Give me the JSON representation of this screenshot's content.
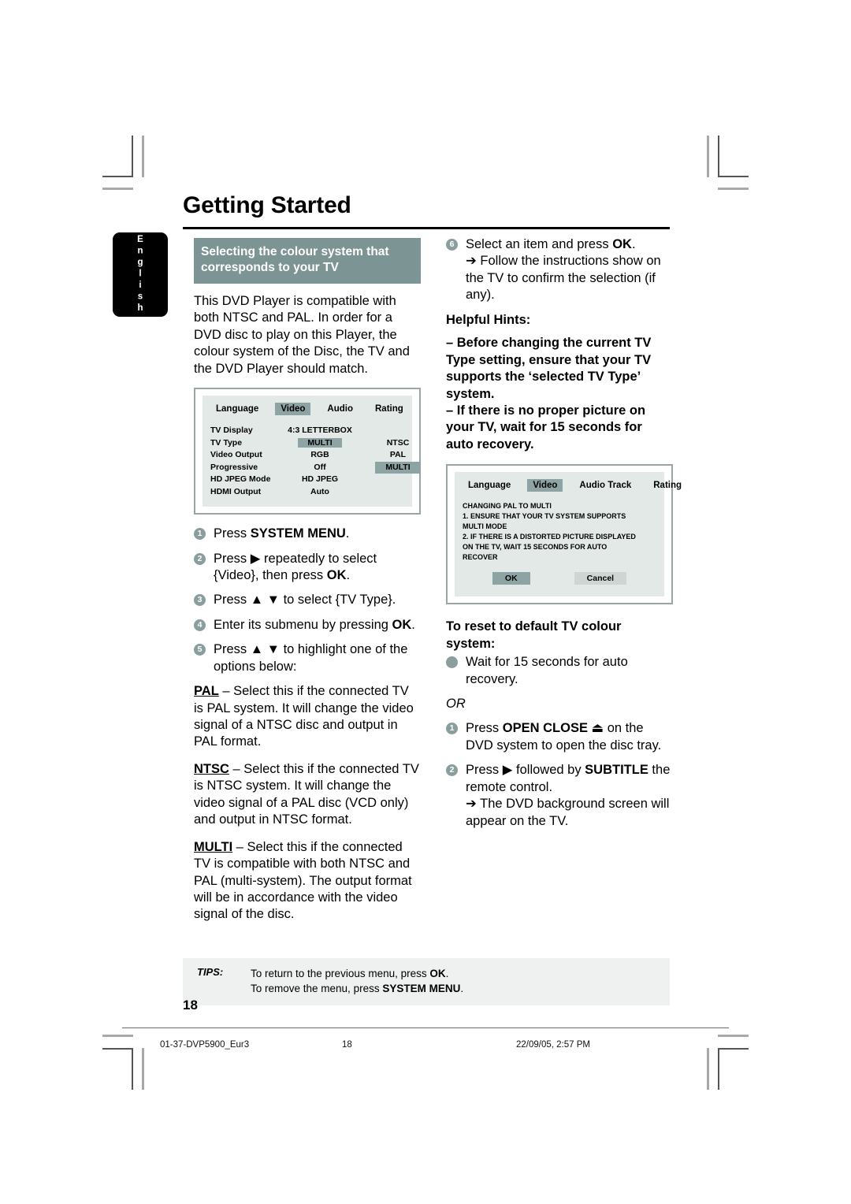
{
  "page": {
    "chapter_title": "Getting Started",
    "side_tab": "English",
    "page_number": "18"
  },
  "left_column": {
    "section_heading": "Selecting the colour system that corresponds to your TV",
    "intro": "This DVD Player is compatible with both NTSC and PAL. In order for a DVD disc to play on this Player, the colour system of the Disc, the TV and the DVD Player should match.",
    "steps": [
      {
        "num": "1",
        "text_html": "Press <span class=\"b\">SYSTEM MENU</span>."
      },
      {
        "num": "2",
        "text_html": "Press ▶ repeatedly to select {Video}, then press <span class=\"b\">OK</span>."
      },
      {
        "num": "3",
        "text_html": "Press ▲ ▼ to select {TV Type}."
      },
      {
        "num": "4",
        "text_html": "Enter its submenu by pressing <span class=\"b\">OK</span>."
      },
      {
        "num": "5",
        "text_html": "Press ▲ ▼ to highlight one of the options below:"
      }
    ],
    "options": [
      {
        "term": "PAL",
        "text": " – Select this if the connected TV is PAL system. It will change the video signal of a NTSC disc and output in PAL format."
      },
      {
        "term": "NTSC",
        "text": " – Select this if the connected TV is NTSC system. It will change the video signal of a PAL disc (VCD only) and output in NTSC format."
      },
      {
        "term": "MULTI",
        "text": " – Select this if the connected TV is compatible with both NTSC and PAL (multi-system). The output format will be in accordance with the video signal of the disc."
      }
    ]
  },
  "osd_video_menu": {
    "tabs": [
      {
        "label": "Language",
        "selected": false
      },
      {
        "label": "Video",
        "selected": true
      },
      {
        "label": "Audio",
        "selected": false
      },
      {
        "label": "Rating",
        "selected": false
      }
    ],
    "rows": [
      {
        "key": "TV Display",
        "value": "4:3 LETTERBOX",
        "highlighted": false
      },
      {
        "key": "TV Type",
        "value": "MULTI",
        "highlighted": true
      },
      {
        "key": "Video Output",
        "value": "RGB",
        "highlighted": false
      },
      {
        "key": "Progressive",
        "value": "Off",
        "highlighted": false
      },
      {
        "key": "HD JPEG Mode",
        "value": "HD JPEG",
        "highlighted": false
      },
      {
        "key": "HDMI Output",
        "value": "Auto",
        "highlighted": false
      }
    ],
    "submenu": [
      {
        "label": "",
        "highlighted": false
      },
      {
        "label": "NTSC",
        "highlighted": false
      },
      {
        "label": "PAL",
        "highlighted": false
      },
      {
        "label": "MULTI",
        "highlighted": true
      }
    ]
  },
  "osd_confirm_dialog": {
    "tabs": [
      {
        "label": "Language",
        "selected": false
      },
      {
        "label": "Video",
        "selected": true
      },
      {
        "label": "Audio Track",
        "selected": false
      },
      {
        "label": "Rating",
        "selected": false
      }
    ],
    "message_lines": [
      "CHANGING PAL TO MULTI",
      "1. ENSURE THAT YOUR TV SYSTEM SUPPORTS",
      "MULTI MODE",
      "2. IF THERE IS A DISTORTED PICTURE DISPLAYED",
      "ON THE TV, WAIT 15 SECONDS FOR AUTO",
      "RECOVER"
    ],
    "buttons": [
      {
        "label": "OK",
        "selected": true
      },
      {
        "label": "Cancel",
        "selected": false
      }
    ]
  },
  "right_column": {
    "step6": {
      "num": "6",
      "text_html": "Select an item and press <span class=\"b\">OK</span>.",
      "result": "➔ Follow the instructions show on the TV to confirm the selection (if any)."
    },
    "helpful_hints_title": "Helpful Hints:",
    "helpful_hints": [
      "–  Before changing the current TV Type setting, ensure that your TV supports the ‘selected TV Type’ system.",
      "–  If there is no proper picture on your TV, wait for 15 seconds for auto recovery."
    ],
    "reset_heading": "To reset to default TV colour system:",
    "reset_bullet": "Wait for 15 seconds for auto recovery.",
    "or_label": "OR",
    "reset_steps": [
      {
        "num": "1",
        "text_html": "Press <span class=\"b\">OPEN CLOSE</span> ⏏ on the DVD system to open the disc tray."
      },
      {
        "num": "2",
        "text_html": "Press ▶ followed by <span class=\"b\">SUBTITLE</span> the remote control."
      }
    ],
    "reset_result": "➔ The DVD background screen will appear on the TV."
  },
  "tips": {
    "label": "TIPS:",
    "line1_html": "To return to the previous menu, press <span class=\"b\">OK</span>.",
    "line2_html": "To remove the menu, press <span class=\"b\">SYSTEM MENU</span>."
  },
  "footer": {
    "file": "01-37-DVP5900_Eur3",
    "page": "18",
    "date": "22/09/05, 2:57 PM"
  },
  "colors": {
    "accent_heading_bg": "#7d9494",
    "bullet": "#8a9e9e",
    "osd_bg": "#e3e9e7",
    "osd_highlight": "#8ea3a3",
    "tips_bg": "#eef1ef"
  }
}
